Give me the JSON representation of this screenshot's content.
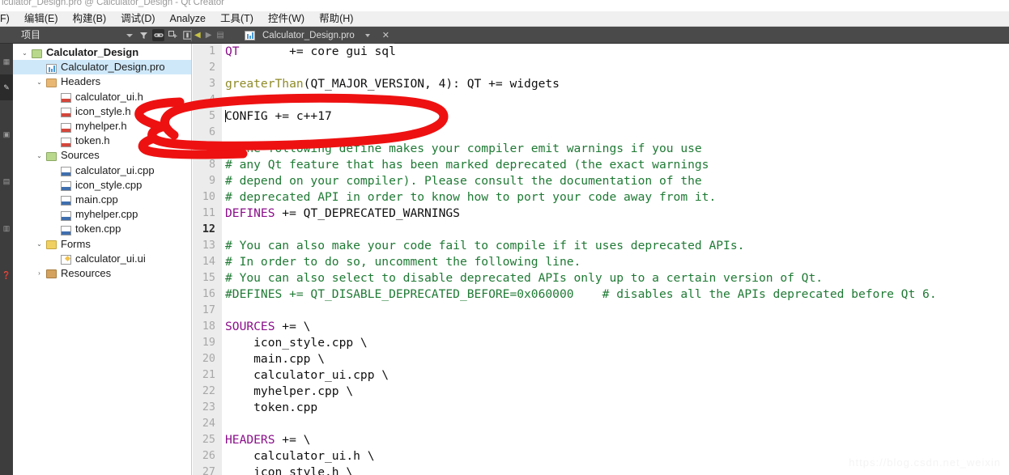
{
  "window": {
    "title": "lculator_Design.pro @ Calculator_Design - Qt Creator"
  },
  "menubar": {
    "items": [
      {
        "label": "F)"
      },
      {
        "label": "编辑(E)"
      },
      {
        "label": "构建(B)"
      },
      {
        "label": "调试(D)"
      },
      {
        "label": "Analyze"
      },
      {
        "label": "工具(T)"
      },
      {
        "label": "控件(W)"
      },
      {
        "label": "帮助(H)"
      }
    ]
  },
  "toolbar": {
    "projects_label": "项目",
    "icons": [
      {
        "name": "filter-icon",
        "glyph": "⊤"
      },
      {
        "name": "link-icon",
        "glyph": "⊂⊃"
      },
      {
        "name": "expand-all-icon",
        "glyph": "⊞"
      },
      {
        "name": "synchronize-icon",
        "glyph": "⊡"
      }
    ],
    "nav": {
      "back_label": "◀",
      "forward_label": "▶",
      "split_label": "▤"
    }
  },
  "editor_tab": {
    "filename": "Calculator_Design.pro",
    "close_label": "✕",
    "icon_name": "pro-file-icon"
  },
  "modebar": {
    "items": [
      {
        "name": "welcome-mode",
        "selected": false
      },
      {
        "name": "edit-mode",
        "selected": true
      },
      {
        "name": "design-mode",
        "selected": false
      },
      {
        "name": "debug-mode",
        "selected": false
      },
      {
        "name": "projects-mode",
        "selected": false
      },
      {
        "name": "help-mode",
        "selected": false
      }
    ]
  },
  "tree": {
    "rows": [
      {
        "indent": 0,
        "twist": "⌄",
        "icon": "folder-project",
        "label": "Calculator_Design",
        "bold": true,
        "selected": false
      },
      {
        "indent": 1,
        "twist": "",
        "icon": "pro-file",
        "label": "Calculator_Design.pro",
        "bold": false,
        "selected": true
      },
      {
        "indent": 1,
        "twist": "⌄",
        "icon": "folder-headers",
        "label": "Headers",
        "bold": false,
        "selected": false
      },
      {
        "indent": 2,
        "twist": "",
        "icon": "header-file",
        "label": "calculator_ui.h",
        "bold": false,
        "selected": false
      },
      {
        "indent": 2,
        "twist": "",
        "icon": "header-file",
        "label": "icon_style.h",
        "bold": false,
        "selected": false
      },
      {
        "indent": 2,
        "twist": "",
        "icon": "header-file",
        "label": "myhelper.h",
        "bold": false,
        "selected": false
      },
      {
        "indent": 2,
        "twist": "",
        "icon": "header-file",
        "label": "token.h",
        "bold": false,
        "selected": false
      },
      {
        "indent": 1,
        "twist": "⌄",
        "icon": "folder-sources",
        "label": "Sources",
        "bold": false,
        "selected": false
      },
      {
        "indent": 2,
        "twist": "",
        "icon": "cpp-file",
        "label": "calculator_ui.cpp",
        "bold": false,
        "selected": false
      },
      {
        "indent": 2,
        "twist": "",
        "icon": "cpp-file",
        "label": "icon_style.cpp",
        "bold": false,
        "selected": false
      },
      {
        "indent": 2,
        "twist": "",
        "icon": "cpp-file",
        "label": "main.cpp",
        "bold": false,
        "selected": false
      },
      {
        "indent": 2,
        "twist": "",
        "icon": "cpp-file",
        "label": "myhelper.cpp",
        "bold": false,
        "selected": false
      },
      {
        "indent": 2,
        "twist": "",
        "icon": "cpp-file",
        "label": "token.cpp",
        "bold": false,
        "selected": false
      },
      {
        "indent": 1,
        "twist": "⌄",
        "icon": "folder-forms",
        "label": "Forms",
        "bold": false,
        "selected": false
      },
      {
        "indent": 2,
        "twist": "",
        "icon": "ui-file",
        "label": "calculator_ui.ui",
        "bold": false,
        "selected": false
      },
      {
        "indent": 1,
        "twist": "›",
        "icon": "folder-res",
        "label": "Resources",
        "bold": false,
        "selected": false
      }
    ]
  },
  "code": {
    "lines": [
      {
        "n": "1",
        "current": false,
        "segs": [
          {
            "t": "QT",
            "c": "k-var"
          },
          {
            "t": "       += core gui sql",
            "c": "k-plain"
          }
        ]
      },
      {
        "n": "2",
        "current": false,
        "segs": []
      },
      {
        "n": "3",
        "current": false,
        "segs": [
          {
            "t": "greaterThan",
            "c": "k-fn"
          },
          {
            "t": "(QT_MAJOR_VERSION, 4): QT += widgets",
            "c": "k-plain"
          }
        ]
      },
      {
        "n": "4",
        "current": false,
        "segs": []
      },
      {
        "n": "5",
        "current": false,
        "caret": true,
        "segs": [
          {
            "t": "CONFIG += c++17",
            "c": "k-plain"
          }
        ]
      },
      {
        "n": "6",
        "current": false,
        "segs": []
      },
      {
        "n": "7",
        "current": false,
        "segs": [
          {
            "t": "# The following define makes your compiler emit warnings if you use",
            "c": "k-cmt"
          }
        ]
      },
      {
        "n": "8",
        "current": false,
        "segs": [
          {
            "t": "# any Qt feature that has been marked deprecated (the exact warnings",
            "c": "k-cmt"
          }
        ]
      },
      {
        "n": "9",
        "current": false,
        "segs": [
          {
            "t": "# depend on your compiler). Please consult the documentation of the",
            "c": "k-cmt"
          }
        ]
      },
      {
        "n": "10",
        "current": false,
        "segs": [
          {
            "t": "# deprecated API in order to know how to port your code away from it.",
            "c": "k-cmt"
          }
        ]
      },
      {
        "n": "11",
        "current": false,
        "segs": [
          {
            "t": "DEFINES",
            "c": "k-var"
          },
          {
            "t": " += QT_DEPRECATED_WARNINGS",
            "c": "k-plain"
          }
        ]
      },
      {
        "n": "12",
        "current": true,
        "segs": []
      },
      {
        "n": "13",
        "current": false,
        "segs": [
          {
            "t": "# You can also make your code fail to compile if it uses deprecated APIs.",
            "c": "k-cmt"
          }
        ]
      },
      {
        "n": "14",
        "current": false,
        "segs": [
          {
            "t": "# In order to do so, uncomment the following line.",
            "c": "k-cmt"
          }
        ]
      },
      {
        "n": "15",
        "current": false,
        "segs": [
          {
            "t": "# You can also select to disable deprecated APIs only up to a certain version of Qt.",
            "c": "k-cmt"
          }
        ]
      },
      {
        "n": "16",
        "current": false,
        "segs": [
          {
            "t": "#DEFINES += QT_DISABLE_DEPRECATED_BEFORE=0x060000    # disables all the APIs deprecated before Qt 6.",
            "c": "k-cmt"
          }
        ]
      },
      {
        "n": "17",
        "current": false,
        "segs": []
      },
      {
        "n": "18",
        "current": false,
        "segs": [
          {
            "t": "SOURCES",
            "c": "k-var"
          },
          {
            "t": " += \\",
            "c": "k-plain"
          }
        ]
      },
      {
        "n": "19",
        "current": false,
        "segs": [
          {
            "t": "    icon_style.cpp \\",
            "c": "k-plain"
          }
        ]
      },
      {
        "n": "20",
        "current": false,
        "segs": [
          {
            "t": "    main.cpp \\",
            "c": "k-plain"
          }
        ]
      },
      {
        "n": "21",
        "current": false,
        "segs": [
          {
            "t": "    calculator_ui.cpp \\",
            "c": "k-plain"
          }
        ]
      },
      {
        "n": "22",
        "current": false,
        "segs": [
          {
            "t": "    myhelper.cpp \\",
            "c": "k-plain"
          }
        ]
      },
      {
        "n": "23",
        "current": false,
        "segs": [
          {
            "t": "    token.cpp",
            "c": "k-plain"
          }
        ]
      },
      {
        "n": "24",
        "current": false,
        "segs": []
      },
      {
        "n": "25",
        "current": false,
        "segs": [
          {
            "t": "HEADERS",
            "c": "k-var"
          },
          {
            "t": " += \\",
            "c": "k-plain"
          }
        ]
      },
      {
        "n": "26",
        "current": false,
        "segs": [
          {
            "t": "    calculator_ui.h \\",
            "c": "k-plain"
          }
        ]
      },
      {
        "n": "27",
        "current": false,
        "segs": [
          {
            "t": "    icon_style.h \\",
            "c": "k-plain"
          }
        ]
      }
    ]
  },
  "annotation": {
    "color": "#ee1111",
    "shape": "hand-drawn-ellipse-around-line-5"
  },
  "watermark": {
    "text": "https://blog.csdn.net_weixin"
  }
}
